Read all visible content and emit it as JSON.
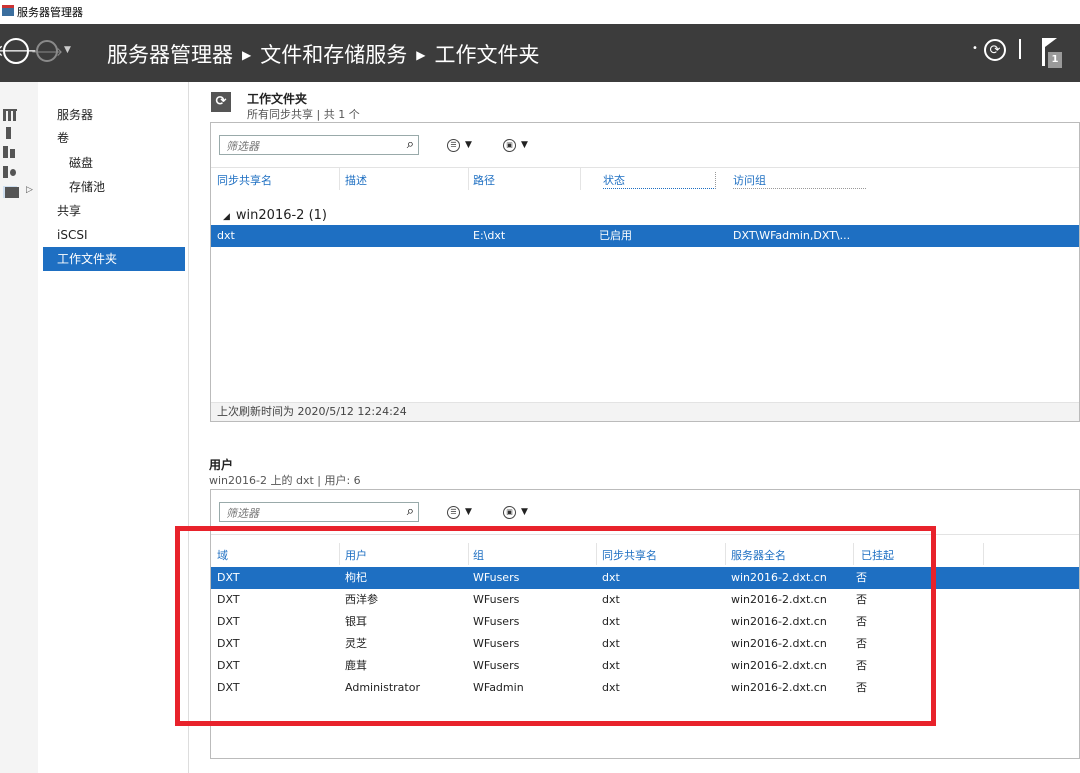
{
  "window": {
    "title": "服务器管理器",
    "app_icon": "server-manager-icon"
  },
  "header": {
    "breadcrumb": [
      "服务器管理器",
      "文件和存储服务",
      "工作文件夹"
    ],
    "notification_count": "1"
  },
  "sidebar": {
    "items": [
      {
        "label": "服务器"
      },
      {
        "label": "卷"
      },
      {
        "label": "磁盘"
      },
      {
        "label": "存储池"
      },
      {
        "label": "共享"
      },
      {
        "label": "iSCSI"
      },
      {
        "label": "工作文件夹"
      }
    ],
    "active": "工作文件夹"
  },
  "work_folders": {
    "title": "工作文件夹",
    "subtitle": "所有同步共享 | 共 1 个",
    "filter_placeholder": "筛选器",
    "columns": [
      "同步共享名",
      "描述",
      "路径",
      "状态",
      "访问组"
    ],
    "group": "win2016-2 (1)",
    "rows": [
      {
        "name": "dxt",
        "desc": "",
        "path": "E:\\dxt",
        "state": "已启用",
        "access": "DXT\\WFadmin,DXT\\..."
      }
    ],
    "status_text": "上次刷新时间为 2020/5/12 12:24:24"
  },
  "users": {
    "title": "用户",
    "subtitle": "win2016-2 上的 dxt | 用户: 6",
    "filter_placeholder": "筛选器",
    "columns": [
      "域",
      "用户",
      "组",
      "同步共享名",
      "服务器全名",
      "已挂起"
    ],
    "rows": [
      {
        "domain": "DXT",
        "user": "枸杞",
        "group": "WFusers",
        "share": "dxt",
        "server": "win2016-2.dxt.cn",
        "suspended": "否"
      },
      {
        "domain": "DXT",
        "user": "西洋参",
        "group": "WFusers",
        "share": "dxt",
        "server": "win2016-2.dxt.cn",
        "suspended": "否"
      },
      {
        "domain": "DXT",
        "user": "银耳",
        "group": "WFusers",
        "share": "dxt",
        "server": "win2016-2.dxt.cn",
        "suspended": "否"
      },
      {
        "domain": "DXT",
        "user": "灵芝",
        "group": "WFusers",
        "share": "dxt",
        "server": "win2016-2.dxt.cn",
        "suspended": "否"
      },
      {
        "domain": "DXT",
        "user": "鹿茸",
        "group": "WFusers",
        "share": "dxt",
        "server": "win2016-2.dxt.cn",
        "suspended": "否"
      },
      {
        "domain": "DXT",
        "user": "Administrator",
        "group": "WFadmin",
        "share": "dxt",
        "server": "win2016-2.dxt.cn",
        "suspended": "否"
      }
    ]
  },
  "colors": {
    "accent": "#1e6fc2",
    "header": "#3c3c3c",
    "annotation": "#e8222b"
  }
}
